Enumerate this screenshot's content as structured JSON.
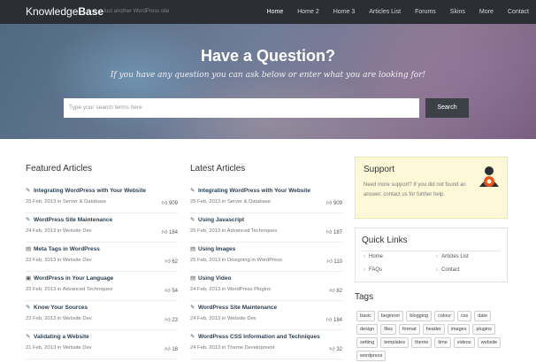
{
  "header": {
    "logo_light": "Knowledge",
    "logo_bold": "Base",
    "tagline": "Just another WordPress site",
    "nav": [
      "Home",
      "Home 2",
      "Home 3",
      "Articles List",
      "Forums",
      "Skins",
      "More",
      "Contact"
    ]
  },
  "hero": {
    "title": "Have a Question?",
    "subtitle": "If you have any question you can ask below or enter what you are looking for!",
    "search_placeholder": "Type your search terms here",
    "search_button": "Search"
  },
  "featured": {
    "title": "Featured Articles",
    "items": [
      {
        "icon": "edit-icon",
        "title": "Integrating WordPress with Your Website",
        "date": "25 Feb, 2013",
        "in": "in",
        "category": "Server & Database",
        "likes": "909"
      },
      {
        "icon": "edit-icon",
        "title": "WordPress Site Maintenance",
        "date": "24 Feb, 2013",
        "in": "in",
        "category": "Website Dev",
        "likes": "184"
      },
      {
        "icon": "film-icon",
        "title": "Meta Tags in WordPress",
        "date": "23 Feb, 2013",
        "in": "in",
        "category": "Website Dev",
        "likes": "62"
      },
      {
        "icon": "image-icon",
        "title": "WordPress in Your Language",
        "date": "22 Feb, 2013",
        "in": "in",
        "category": "Advanced Techniques",
        "likes": "54"
      },
      {
        "icon": "edit-icon",
        "title": "Know Your Sources",
        "date": "22 Feb, 2013",
        "in": "in",
        "category": "Website Dev",
        "likes": "23"
      },
      {
        "icon": "edit-icon",
        "title": "Validating a Website",
        "date": "21 Feb, 2013",
        "in": "in",
        "category": "Website Dev",
        "likes": "18"
      }
    ]
  },
  "latest": {
    "title": "Latest Articles",
    "items": [
      {
        "icon": "edit-icon",
        "title": "Integrating WordPress with Your Website",
        "date": "25 Feb, 2013",
        "in": "in",
        "category": "Server & Database",
        "likes": "909"
      },
      {
        "icon": "edit-icon",
        "title": "Using Javascript",
        "date": "25 Feb, 2013",
        "in": "in",
        "category": "Advanced Techniques",
        "likes": "187"
      },
      {
        "icon": "film-icon",
        "title": "Using Images",
        "date": "25 Feb, 2013",
        "in": "in",
        "category": "Designing in WordPress",
        "likes": "110"
      },
      {
        "icon": "film-icon",
        "title": "Using Video",
        "date": "24 Feb, 2013",
        "in": "in",
        "category": "WordPress Plugins",
        "likes": "82"
      },
      {
        "icon": "edit-icon",
        "title": "WordPress Site Maintenance",
        "date": "24 Feb, 2013",
        "in": "in",
        "category": "Website Dev",
        "likes": "184"
      },
      {
        "icon": "edit-icon",
        "title": "WordPress CSS Information and Techniques",
        "date": "24 Feb, 2013",
        "in": "in",
        "category": "Theme Development",
        "likes": "32"
      }
    ]
  },
  "support": {
    "title": "Support",
    "text": "Need more support? If you did not found an answer, contact us for further help."
  },
  "quick_links": {
    "title": "Quick Links",
    "links": [
      "Home",
      "Articles List",
      "FAQs",
      "Contact"
    ]
  },
  "tags": {
    "title": "Tags",
    "items": [
      "basic",
      "beginner",
      "blogging",
      "colour",
      "css",
      "date",
      "design",
      "files",
      "format",
      "header",
      "images",
      "plugins",
      "setting",
      "templates",
      "theme",
      "time",
      "videos",
      "website",
      "wordpress"
    ]
  },
  "colors": {
    "topbar": "#2b2e33",
    "search_button": "#3c4147",
    "support_bg": "#fdf9d8",
    "support_icon": "#e8541e"
  }
}
